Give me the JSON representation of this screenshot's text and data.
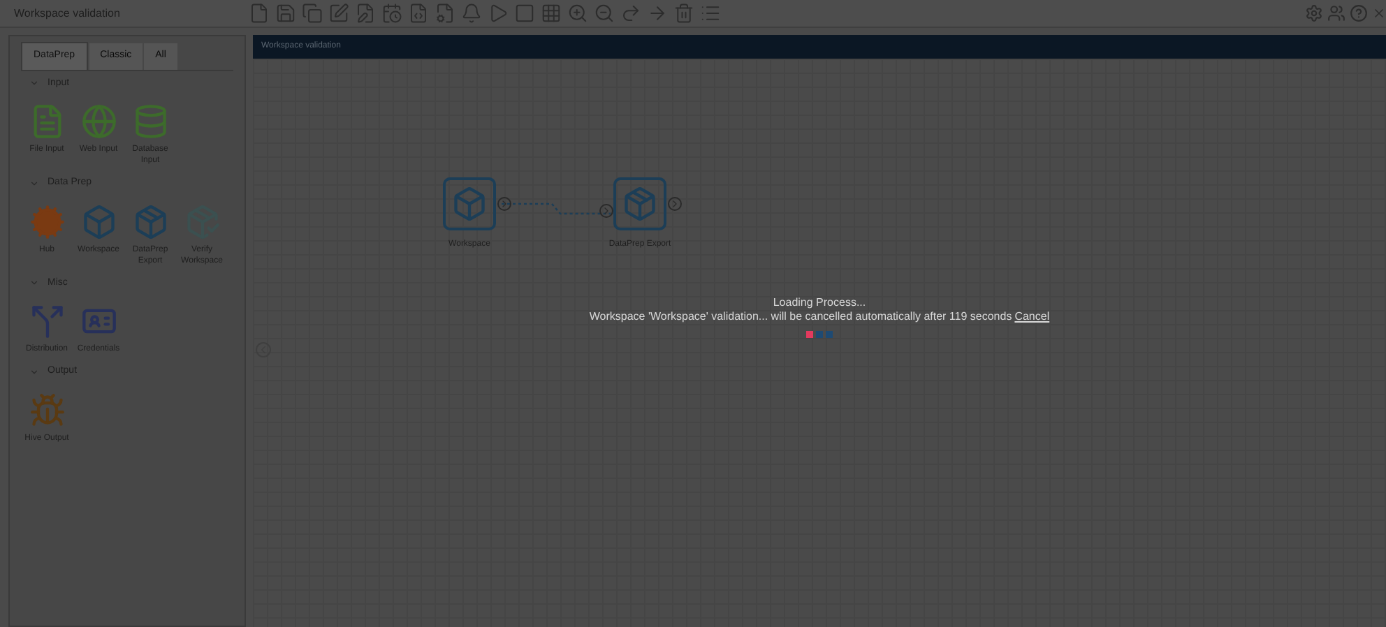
{
  "window": {
    "title": "Workspace validation"
  },
  "sidebar": {
    "tabs": [
      {
        "label": "DataPrep",
        "selected": true
      },
      {
        "label": "Classic",
        "selected": false
      },
      {
        "label": "All",
        "selected": false
      }
    ],
    "groups": [
      {
        "title": "Input",
        "expanded": true,
        "items": [
          {
            "label": "File Input",
            "kind": "file"
          },
          {
            "label": "Web Input",
            "kind": "web"
          },
          {
            "label": "Database Input",
            "kind": "database"
          }
        ]
      },
      {
        "title": "Data Prep",
        "expanded": true,
        "items": [
          {
            "label": "Hub",
            "kind": "hub"
          },
          {
            "label": "Workspace",
            "kind": "workspace"
          },
          {
            "label": "DataPrep Export",
            "kind": "export"
          },
          {
            "label": "Verify Workspace",
            "kind": "verify"
          }
        ]
      },
      {
        "title": "Misc",
        "expanded": true,
        "items": [
          {
            "label": "Distribution",
            "kind": "distribution"
          },
          {
            "label": "Credentials",
            "kind": "credentials"
          }
        ]
      },
      {
        "title": "Output",
        "expanded": true,
        "items": [
          {
            "label": "Hive Output",
            "kind": "hive"
          }
        ]
      }
    ]
  },
  "canvas": {
    "title": "Workspace validation",
    "nodes": [
      {
        "label": "Workspace",
        "kind": "workspace"
      },
      {
        "label": "DataPrep Export",
        "kind": "export"
      }
    ]
  },
  "loading": {
    "title": "Loading Process...",
    "message": "Workspace 'Workspace' validation... will be cancelled automatically after 119 seconds",
    "cancel": "Cancel",
    "dots": [
      {
        "color": "#e33a5e"
      },
      {
        "color": "#1e4a73"
      },
      {
        "color": "#1e4a73"
      }
    ]
  }
}
